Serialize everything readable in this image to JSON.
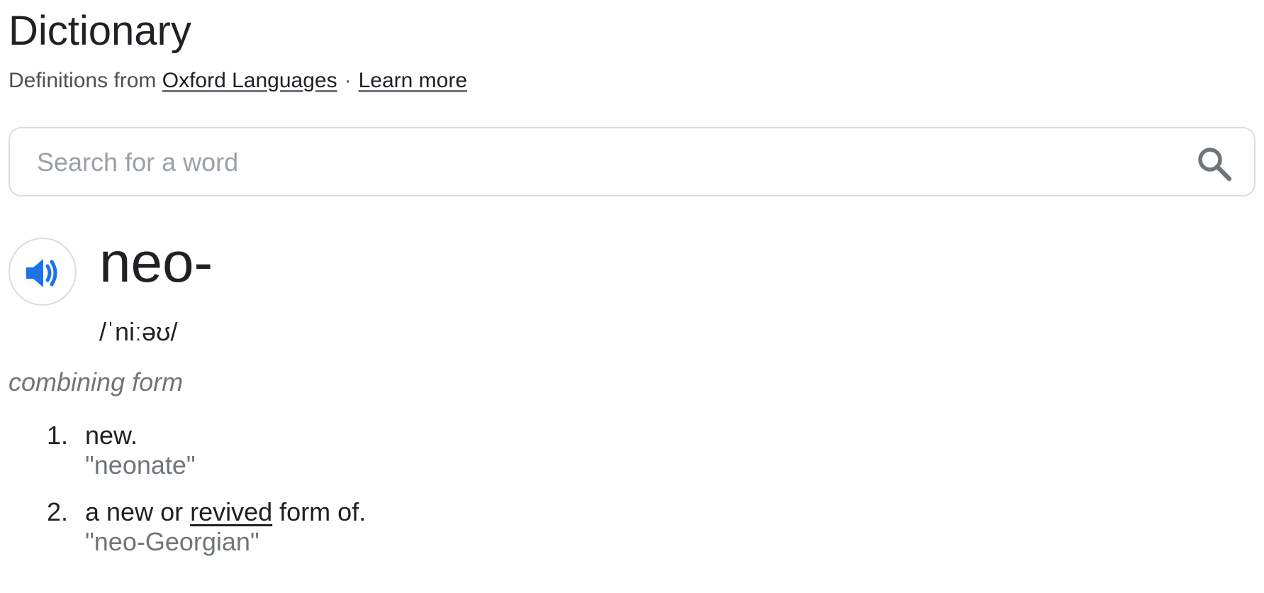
{
  "header": {
    "title": "Dictionary",
    "source_prefix": "Definitions from",
    "source_link": "Oxford Languages",
    "separator": "·",
    "learn_more": "Learn more"
  },
  "search": {
    "placeholder": "Search for a word",
    "value": ""
  },
  "entry": {
    "word": "neo-",
    "phonetic": "/ˈniːəʊ/",
    "part_of_speech": "combining form",
    "senses": [
      {
        "number": "1.",
        "definition": "new.",
        "example": "\"neonate\""
      },
      {
        "number": "2.",
        "definition_before": "a new or",
        "definition_link": "revived",
        "definition_after": "form of.",
        "example": "\"neo-Georgian\""
      }
    ]
  },
  "icons": {
    "search": "search-icon",
    "speaker": "speaker-icon"
  },
  "colors": {
    "accent": "#1a73e8",
    "text": "#202124",
    "secondary_text": "#70757a",
    "border": "#dadce0"
  }
}
